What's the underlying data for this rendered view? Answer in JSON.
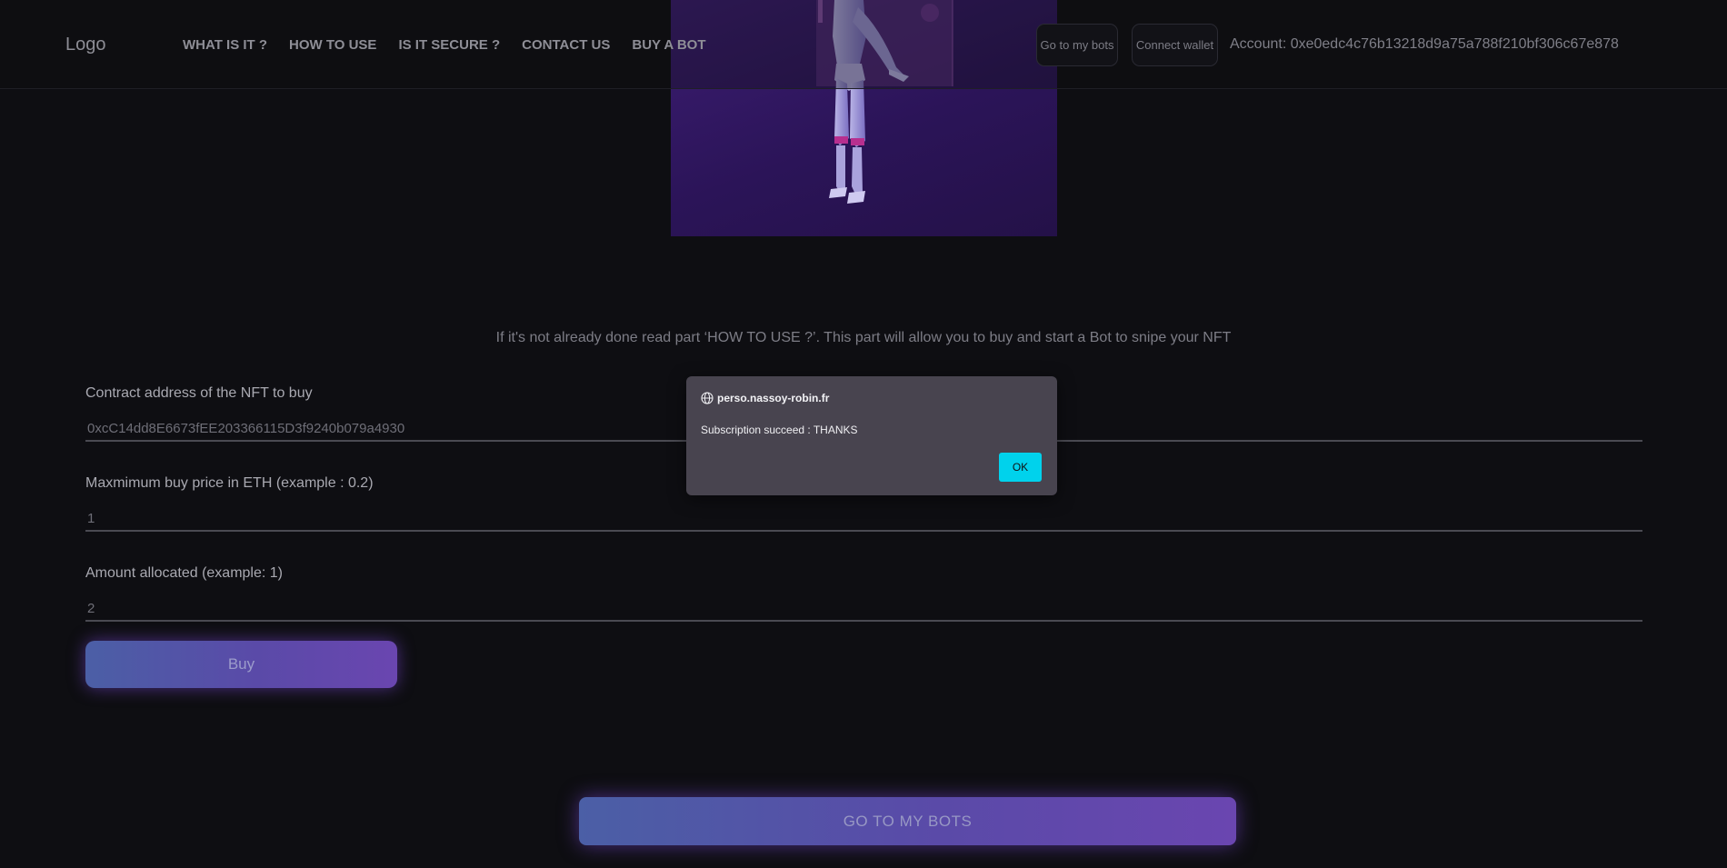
{
  "header": {
    "logo": "Logo",
    "nav": [
      "WHAT IS IT ?",
      "HOW TO USE",
      "IS IT SECURE ?",
      "CONTACT US",
      "BUY A BOT"
    ],
    "go_to_bots_label": "Go to my bots",
    "connect_wallet_label": "Connect wallet",
    "account_label": "Account: 0xe0edc4c76b13218d9a75a788f210bf306c67e878"
  },
  "main": {
    "intro_text": "If it's not already done read part ‘HOW TO USE ?’. This part will allow you to buy and start a Bot to snipe your NFT",
    "fields": [
      {
        "label": "Contract address of the NFT to buy",
        "value": "0xcC14dd8E6673fEE203366115D3f9240b079a4930"
      },
      {
        "label": "Maxmimum buy price in ETH (example : 0.2)",
        "value": "1"
      },
      {
        "label": "Amount allocated (example: 1)",
        "value": "2"
      }
    ],
    "buy_label": "Buy",
    "go_to_bots_label": "GO TO MY BOTS"
  },
  "dialog": {
    "origin": "perso.nassoy-robin.fr",
    "message": "Subscription succeed : THANKS",
    "ok_label": "OK"
  },
  "icons": {
    "dialog_origin": "globe-icon",
    "hero": "robot-illustration"
  },
  "colors": {
    "background": "#0e0e12",
    "accent_gradient_start": "#4b5fa6",
    "accent_gradient_end": "#6a46b0",
    "dialog_background": "#48444f",
    "ok_button": "#00d2ec"
  }
}
